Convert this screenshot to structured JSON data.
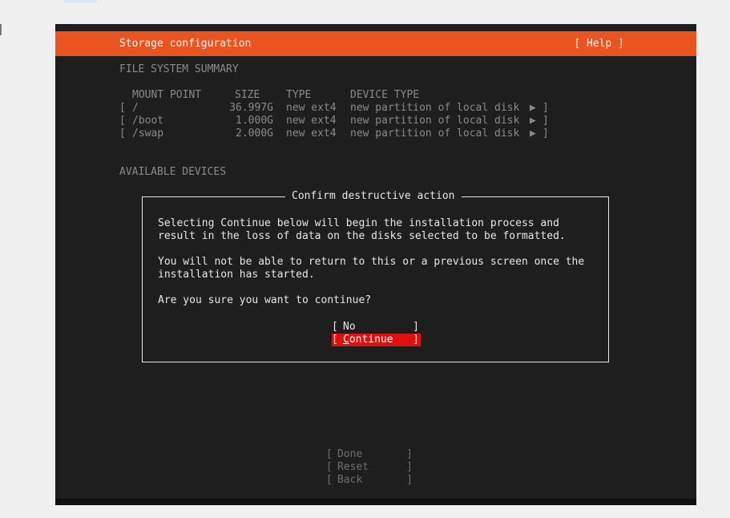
{
  "header": {
    "title": "Storage configuration",
    "help": "[ Help ]"
  },
  "summary": {
    "heading": "FILE SYSTEM SUMMARY",
    "columns": [
      "MOUNT POINT",
      "SIZE",
      "TYPE",
      "DEVICE TYPE"
    ],
    "rows": [
      {
        "open": "[",
        "mount": "/",
        "size": "36.997G",
        "type": "new ext4",
        "device": "new partition of local disk",
        "arrow": "▶",
        "close": "]"
      },
      {
        "open": "[",
        "mount": "/boot",
        "size": "1.000G",
        "type": "new ext4",
        "device": "new partition of local disk",
        "arrow": "▶",
        "close": "]"
      },
      {
        "open": "[",
        "mount": "/swap",
        "size": "2.000G",
        "type": "new ext4",
        "device": "new partition of local disk",
        "arrow": "▶",
        "close": "]"
      }
    ]
  },
  "available_devices": {
    "heading": "AVAILABLE DEVICES"
  },
  "dialog": {
    "title": "Confirm destructive action",
    "lines": [
      "Selecting Continue below will begin the installation process and",
      "result in the loss of data on the disks selected to be formatted.",
      "You will not be able to return to this or a previous screen once the",
      "installation has started.",
      "Are you sure you want to continue?"
    ],
    "no_button": {
      "open": "[",
      "label": "No",
      "close": "]"
    },
    "continue_button": {
      "open": "[",
      "label_first": "C",
      "label_rest": "ontinue",
      "close": "]"
    }
  },
  "footer": {
    "buttons": [
      {
        "open": "[",
        "label": "Done",
        "close": "]"
      },
      {
        "open": "[",
        "label": "Reset",
        "close": "]"
      },
      {
        "open": "[",
        "label": "Back",
        "close": "]"
      }
    ]
  },
  "colors": {
    "accent": "#e95420",
    "selected_button": "#e01010",
    "terminal_bg": "#1e1e1e"
  }
}
